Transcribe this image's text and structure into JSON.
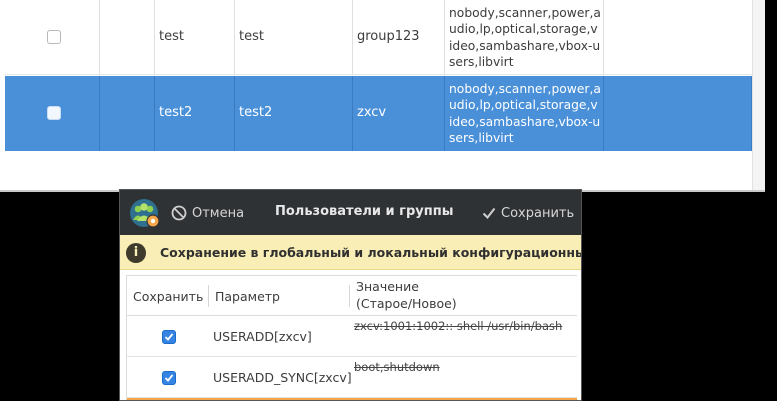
{
  "users_table": {
    "rows": [
      {
        "name": "test",
        "full_name": "test",
        "group": "group123",
        "groups": "nobody,scanner,power,audio,lp,optical,storage,video,sambashare,vbox-users,libvirt",
        "selected": false
      },
      {
        "name": "test2",
        "full_name": "test2",
        "group": "zxcv",
        "groups": "nobody,scanner,power,audio,lp,optical,storage,video,sambashare,vbox-users,libvirt",
        "selected": true
      }
    ],
    "selection_color": "#4a90d9"
  },
  "dialog": {
    "header": {
      "cancel_label": "Отмена",
      "title": "Пользователи и группы",
      "save_label": "Сохранить"
    },
    "info": {
      "icon": "i",
      "text": "Сохранение в глобальный и локальный конфигурационный файл"
    },
    "columns": {
      "save": "Сохранить",
      "param": "Параметр",
      "value_line1": "Значение",
      "value_line2": "(Старое/Новое)"
    },
    "rows": [
      {
        "param": "USERADD[zxcv]",
        "old_value": "zxcv:1001:1002::    shell /usr/bin/bash",
        "checked": true
      },
      {
        "param": "USERADD_SYNC[zxcv]",
        "old_value": "boot,shutdown",
        "checked": true
      }
    ],
    "colors": {
      "headerbar": "#2f3234",
      "info_bg": "#f9eeb5",
      "checkbox": "#3584e4",
      "accent_bar": "#f5a54a"
    }
  }
}
